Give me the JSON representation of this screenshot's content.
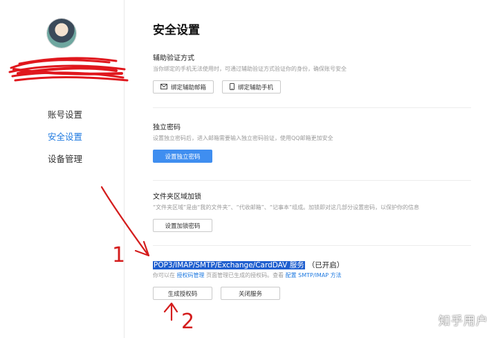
{
  "sidebar": {
    "items": [
      {
        "label": "账号设置",
        "active": false
      },
      {
        "label": "安全设置",
        "active": true
      },
      {
        "label": "设备管理",
        "active": false
      }
    ]
  },
  "main": {
    "title": "安全设置",
    "aux_verify": {
      "title": "辅助验证方式",
      "desc": "当你绑定的手机无法使用时，可通过辅助验证方式验证你的身份，确保账号安全",
      "btn_email": "绑定辅助邮箱",
      "btn_phone": "绑定辅助手机"
    },
    "independent_pwd": {
      "title": "独立密码",
      "desc": "设置独立密码后，进入邮箱需要输入独立密码验证，使用QQ邮箱更加安全",
      "btn": "设置独立密码"
    },
    "folder_lock": {
      "title": "文件夹区域加锁",
      "desc": "“文件夹区域”是由“我的文件夹”、“代收邮箱”、“记事本”组成。加锁即对这几部分设置密码，以保护你的信息",
      "btn": "设置加锁密码"
    },
    "protocol": {
      "title": "POP3/IMAP/SMTP/Exchange/CardDAV 服务",
      "status": "（已开启）",
      "desc_pre": "你可以在",
      "desc_link1": "授权码管理",
      "desc_mid": "页面管理已生成的授权码。查看",
      "desc_link2": "配置 SMTP/IMAP 方法",
      "btn_generate": "生成授权码",
      "btn_close": "关闭服务"
    }
  },
  "annotations": {
    "label1": "1",
    "label2": "2",
    "color": "#d41d1d"
  },
  "watermark": "知乎用户",
  "colors": {
    "accent": "#1f7ae0",
    "primary_button": "#3f8ef0",
    "highlight": "#1f5fcf"
  }
}
